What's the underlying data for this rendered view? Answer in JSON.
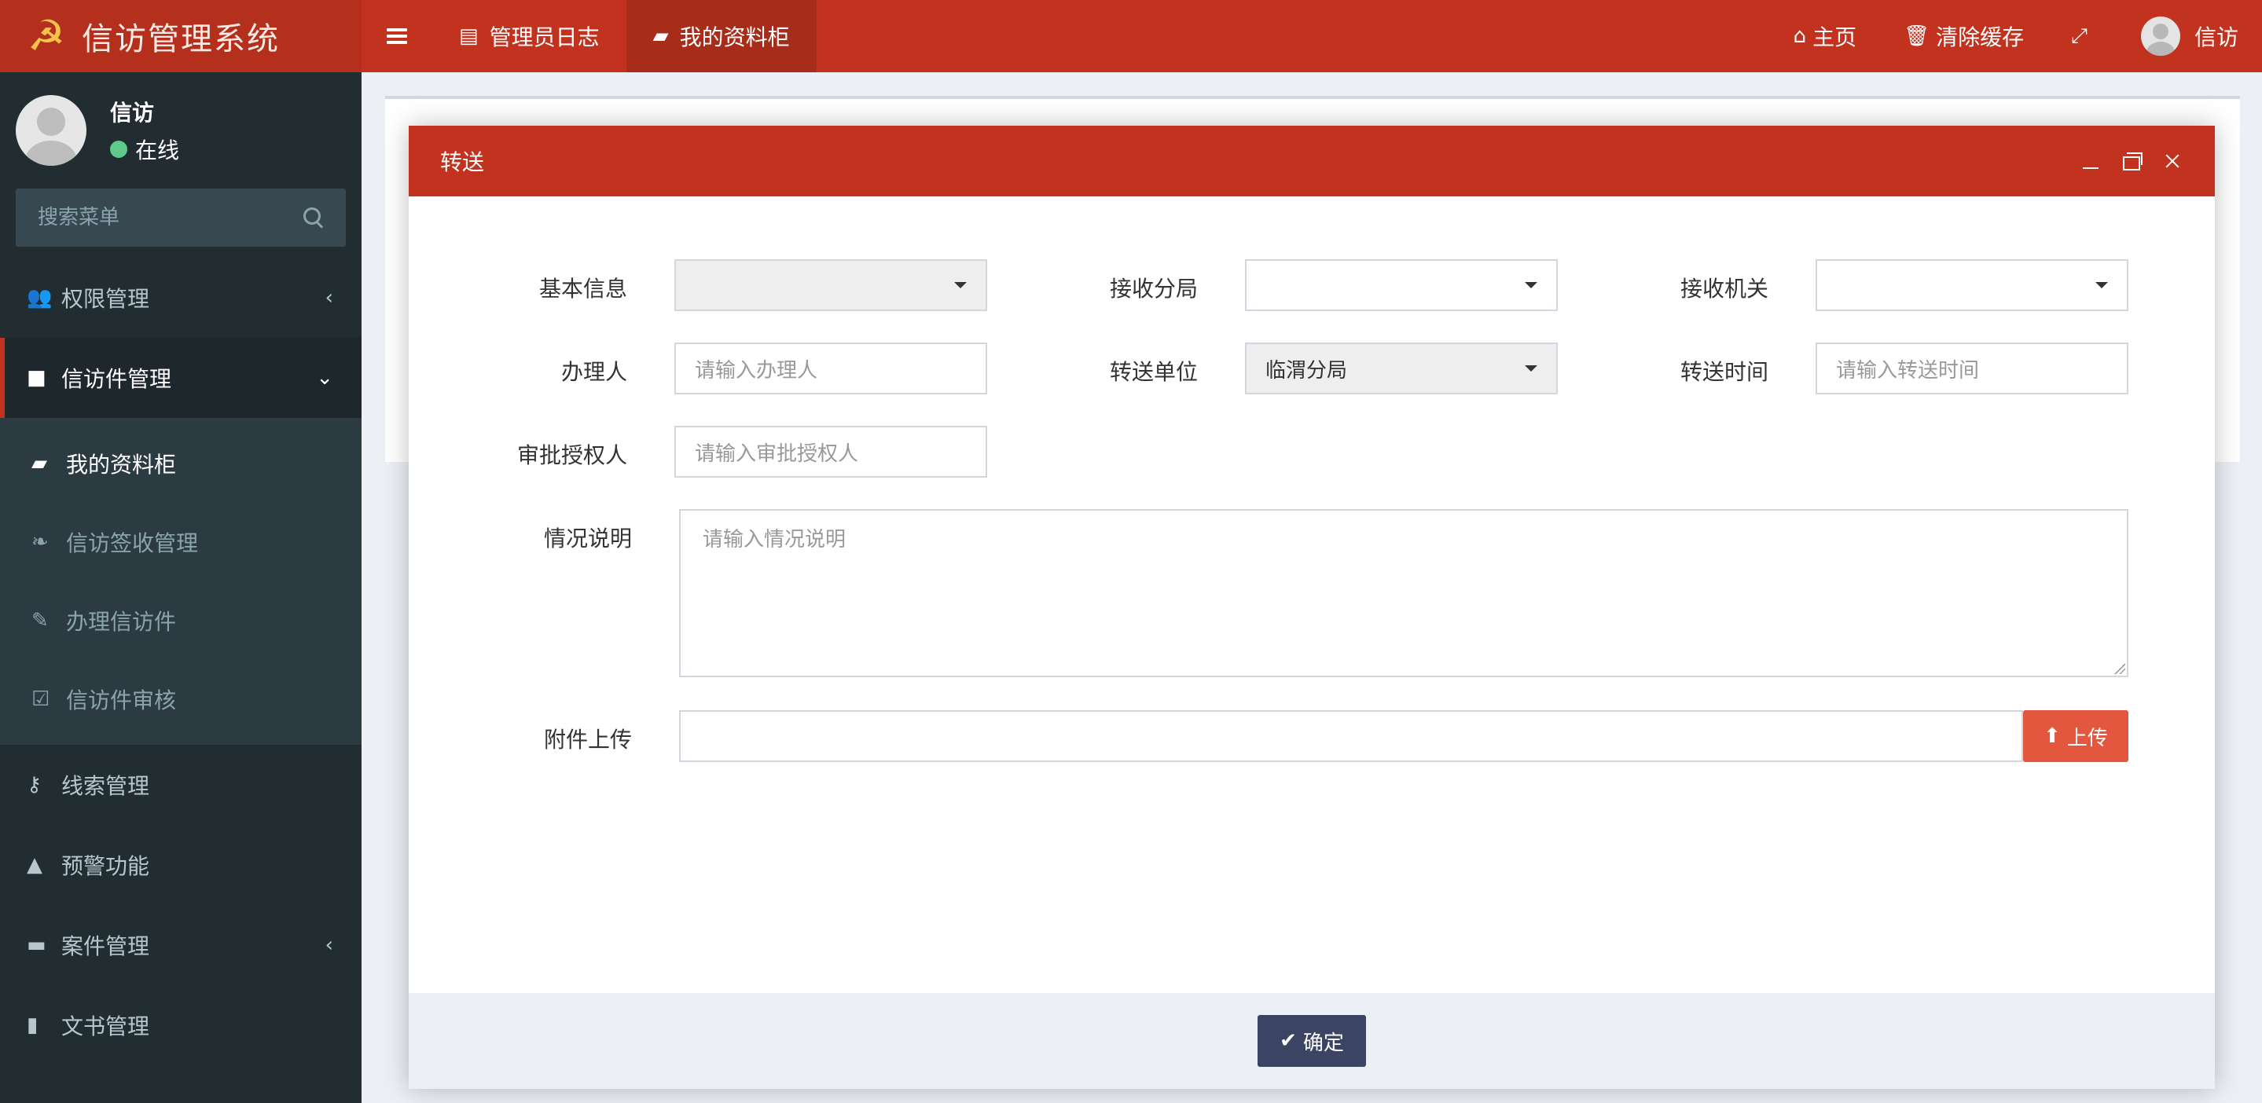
{
  "header": {
    "logo_text": "信访管理系统",
    "logo_icon": "hammer-sickle-icon",
    "tabs": [
      {
        "label": "管理员日志",
        "icon": "list-icon"
      },
      {
        "label": "我的资料柜",
        "icon": "folder-open-icon"
      }
    ],
    "right": {
      "home": "主页",
      "clear_cache": "清除缓存",
      "user": "信访"
    }
  },
  "sidebar": {
    "user": {
      "name": "信访",
      "status": "在线",
      "status_color": "#5fcb8a"
    },
    "search_placeholder": "搜索菜单",
    "items": [
      {
        "label": "权限管理",
        "icon": "users-icon"
      },
      {
        "label": "信访件管理",
        "icon": "folder-icon"
      },
      {
        "label": "线索管理",
        "icon": "key-icon"
      },
      {
        "label": "预警功能",
        "icon": "warning-icon"
      },
      {
        "label": "案件管理",
        "icon": "archive-icon"
      },
      {
        "label": "文书管理",
        "icon": "book-icon"
      }
    ],
    "subitems": [
      {
        "label": "我的资料柜",
        "icon": "folder-open-icon"
      },
      {
        "label": "信访签收管理",
        "icon": "leaf-icon"
      },
      {
        "label": "办理信访件",
        "icon": "edit-icon"
      },
      {
        "label": "信访件审核",
        "icon": "check-square-icon"
      }
    ]
  },
  "modal": {
    "title": "转送",
    "form": {
      "basic_info": {
        "label": "基本信息",
        "value": ""
      },
      "receive_branch": {
        "label": "接收分局",
        "value": ""
      },
      "receive_org": {
        "label": "接收机关",
        "value": ""
      },
      "handler": {
        "label": "办理人",
        "placeholder": "请输入办理人"
      },
      "transfer_unit": {
        "label": "转送单位",
        "value": "临渭分局"
      },
      "transfer_time": {
        "label": "转送时间",
        "placeholder": "请输入转送时间"
      },
      "approver": {
        "label": "审批授权人",
        "placeholder": "请输入审批授权人"
      },
      "description": {
        "label": "情况说明",
        "placeholder": "请输入情况说明"
      },
      "attachment": {
        "label": "附件上传",
        "button": "上传"
      }
    },
    "confirm": "确定"
  },
  "colors": {
    "brand": "#c1321f",
    "sidebar": "#222d32",
    "upload": "#e4573f",
    "confirm": "#3c4463"
  }
}
